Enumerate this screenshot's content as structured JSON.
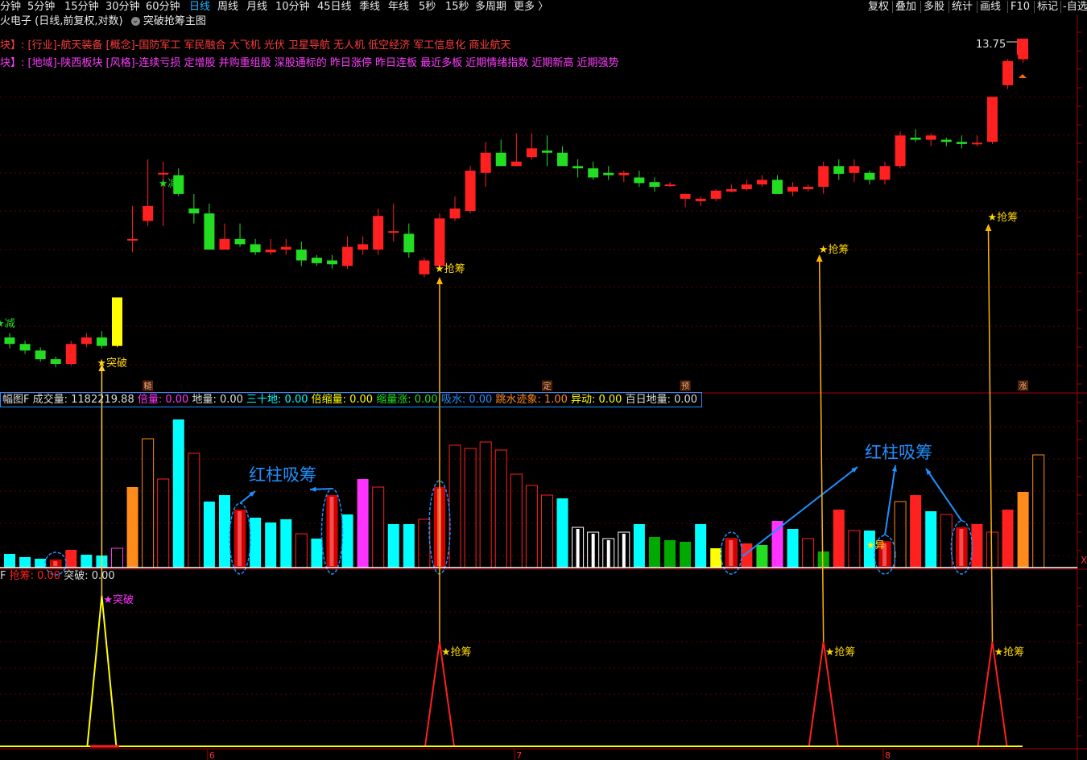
{
  "topbar": {
    "periods": [
      "分钟",
      "5分钟",
      "15分钟",
      "30分钟",
      "60分钟",
      "日线",
      "周线",
      "月线",
      "10分钟",
      "45日线",
      "季线",
      "年线",
      "5秒",
      "15秒",
      "多周期",
      "更多 〉"
    ],
    "active_period": "日线",
    "right_buttons": [
      "复权",
      "叠加",
      "多股",
      "统计",
      "画线",
      "F10",
      "标记",
      "-自选"
    ]
  },
  "title": {
    "stock": "火电子 (日线,前复权,对数)",
    "formula": "突破抢筹主图"
  },
  "tags": {
    "line1_prefix": "块】:",
    "line1": "[行业]-航天装备 [概念]-国防军工 军民融合 大飞机 光伏 卫星导航 无人机 低空经济 军工信息化 商业航天",
    "line2_prefix": "块】:",
    "line2": "[地域]-陕西板块 [风格]-连续亏损 定增股 并购重组股 深股通标的 昨日涨停 昨日连板 最近多板 近期情绪指数 近期新高 近期强势"
  },
  "colors": {
    "up": "#ff2020",
    "down": "#22dd22",
    "cyan": "#00ffff",
    "magenta": "#ff33ff",
    "orange": "#ff8c1a",
    "yellow": "#ffff00",
    "darkgreen": "#00aa00",
    "annotation": "#1e90ff",
    "arrow": "#ffb400"
  },
  "price_panel": {
    "price_label": "13.75",
    "markers": [
      {
        "text": "★减",
        "candle": 0,
        "color": "#22dd22"
      },
      {
        "text": "★突破",
        "candle": 6,
        "color": "#ffd700"
      },
      {
        "text": "★减",
        "candle": 10,
        "color": "#22dd22"
      },
      {
        "text": "★抢筹",
        "candle": 28,
        "color": "#ffd700"
      },
      {
        "text": "★抢筹",
        "candle": 53,
        "color": "#ffd700"
      },
      {
        "text": "★抢筹",
        "candle": 64,
        "color": "#ffd700"
      }
    ],
    "badges": [
      {
        "text": "糙",
        "candle": 9
      },
      {
        "text": "定",
        "candle": 35
      },
      {
        "text": "预",
        "candle": 44
      },
      {
        "text": "涨",
        "candle": 66
      }
    ]
  },
  "volume_panel": {
    "header": [
      {
        "text": "幅图F ",
        "color": "#dddddd"
      },
      {
        "text": "成交量: 1182219.88 ",
        "color": "#dddddd"
      },
      {
        "text": "倍量: 0.00 ",
        "color": "#ff33ff"
      },
      {
        "text": "地量: 0.00 ",
        "color": "#dddddd"
      },
      {
        "text": "三十地: 0.00 ",
        "color": "#00ffff"
      },
      {
        "text": "倍缩量: 0.00 ",
        "color": "#ffff00"
      },
      {
        "text": "缩量涨: 0.00 ",
        "color": "#22dd22"
      },
      {
        "text": "吸水: 0.00 ",
        "color": "#1e90ff"
      },
      {
        "text": "跳水迹象: 1.00 ",
        "color": "#ff8c1a"
      },
      {
        "text": "异动: 0.00 ",
        "color": "#ffff00"
      },
      {
        "text": "百日地量: 0.00",
        "color": "#dddddd"
      }
    ],
    "annotation_text": "红柱吸筹",
    "yi_label": "★异"
  },
  "signal_panel": {
    "header": [
      {
        "text": "F ",
        "color": "#dddddd"
      },
      {
        "text": "抢筹: 0.00 ",
        "color": "#ff2020"
      },
      {
        "text": "突破: 0.00",
        "color": "#dddddd"
      }
    ],
    "labels": [
      {
        "text": "★突破",
        "candle": 6,
        "color": "#ff33ff"
      },
      {
        "text": "★抢筹",
        "candle": 28,
        "color": "#ffd700"
      },
      {
        "text": "★抢筹",
        "candle": 53,
        "color": "#ffd700"
      },
      {
        "text": "★抢筹",
        "candle": 64,
        "color": "#ffd700"
      }
    ]
  },
  "x_axis_labels": [
    {
      "text": "6",
      "candle": 13
    },
    {
      "text": "7",
      "candle": 33
    },
    {
      "text": "8",
      "candle": 57
    }
  ],
  "chart_data": {
    "type": "candlestick",
    "scale": "log",
    "ohlc": [
      [
        7.55,
        7.62,
        7.38,
        7.45
      ],
      [
        7.45,
        7.5,
        7.3,
        7.35
      ],
      [
        7.35,
        7.4,
        7.18,
        7.22
      ],
      [
        7.22,
        7.26,
        7.1,
        7.15
      ],
      [
        7.15,
        7.5,
        7.12,
        7.45
      ],
      [
        7.45,
        7.62,
        7.4,
        7.55
      ],
      [
        7.55,
        7.65,
        7.38,
        7.42
      ],
      [
        7.42,
        8.2,
        7.4,
        8.2
      ],
      [
        9.25,
        9.9,
        9.0,
        9.25
      ],
      [
        9.6,
        10.9,
        9.5,
        9.9
      ],
      [
        10.6,
        10.85,
        9.5,
        10.6
      ],
      [
        10.55,
        10.7,
        10.1,
        10.15
      ],
      [
        9.85,
        10.15,
        9.55,
        9.75
      ],
      [
        9.75,
        9.95,
        9.1,
        9.05
      ],
      [
        9.05,
        9.55,
        9.2,
        9.25
      ],
      [
        9.25,
        9.55,
        9.1,
        9.15
      ],
      [
        9.15,
        9.25,
        8.95,
        9.0
      ],
      [
        9.0,
        9.25,
        8.95,
        9.05
      ],
      [
        9.05,
        9.25,
        8.95,
        9.1
      ],
      [
        9.05,
        9.2,
        8.75,
        8.85
      ],
      [
        8.9,
        8.95,
        8.75,
        8.8
      ],
      [
        8.85,
        8.95,
        8.7,
        8.78
      ],
      [
        8.75,
        9.3,
        8.7,
        9.1
      ],
      [
        9.05,
        9.3,
        8.95,
        9.15
      ],
      [
        9.05,
        9.85,
        8.95,
        9.7
      ],
      [
        9.4,
        9.95,
        9.2,
        9.4
      ],
      [
        9.35,
        9.55,
        8.9,
        9.0
      ],
      [
        8.6,
        8.9,
        8.55,
        8.85
      ],
      [
        8.75,
        9.75,
        8.7,
        9.65
      ],
      [
        9.65,
        10.1,
        9.6,
        9.85
      ],
      [
        9.8,
        10.75,
        9.75,
        10.65
      ],
      [
        10.6,
        11.3,
        10.3,
        11.05
      ],
      [
        11.05,
        11.35,
        10.8,
        10.75
      ],
      [
        10.75,
        11.5,
        10.8,
        10.85
      ],
      [
        10.95,
        11.5,
        10.9,
        11.15
      ],
      [
        11.1,
        11.45,
        10.75,
        11.05
      ],
      [
        11.05,
        11.2,
        10.8,
        10.75
      ],
      [
        10.75,
        10.9,
        10.5,
        10.7
      ],
      [
        10.7,
        10.85,
        10.45,
        10.5
      ],
      [
        10.6,
        10.75,
        10.45,
        10.55
      ],
      [
        10.55,
        10.65,
        10.4,
        10.6
      ],
      [
        10.5,
        10.65,
        10.3,
        10.38
      ],
      [
        10.4,
        10.5,
        10.2,
        10.3
      ],
      [
        10.35,
        10.4,
        10.3,
        10.35
      ],
      [
        10.05,
        10.15,
        9.88,
        10.15
      ],
      [
        10.0,
        10.1,
        9.9,
        10.05
      ],
      [
        10.05,
        10.25,
        10.0,
        10.22
      ],
      [
        10.2,
        10.35,
        10.18,
        10.25
      ],
      [
        10.25,
        10.45,
        10.22,
        10.35
      ],
      [
        10.35,
        10.55,
        10.3,
        10.45
      ],
      [
        10.45,
        10.55,
        10.15,
        10.15
      ],
      [
        10.2,
        10.4,
        10.1,
        10.3
      ],
      [
        10.25,
        10.35,
        10.2,
        10.3
      ],
      [
        10.3,
        10.85,
        10.15,
        10.75
      ],
      [
        10.75,
        10.9,
        10.45,
        10.58
      ],
      [
        10.6,
        10.9,
        10.4,
        10.75
      ],
      [
        10.6,
        10.65,
        10.35,
        10.45
      ],
      [
        10.45,
        10.85,
        10.35,
        10.75
      ],
      [
        10.75,
        11.55,
        10.7,
        11.45
      ],
      [
        11.4,
        11.6,
        11.3,
        11.35
      ],
      [
        11.35,
        11.5,
        11.2,
        11.45
      ],
      [
        11.35,
        11.4,
        11.2,
        11.3
      ],
      [
        11.3,
        11.45,
        11.15,
        11.25
      ],
      [
        11.25,
        11.45,
        11.2,
        11.28
      ],
      [
        11.3,
        12.4,
        11.25,
        12.4
      ],
      [
        12.7,
        13.4,
        12.6,
        13.35
      ],
      [
        13.4,
        13.75,
        13.3,
        13.75
      ]
    ],
    "volume_bars": [
      {
        "v": 0.085,
        "c": "cyan"
      },
      {
        "v": 0.065,
        "c": "cyan"
      },
      {
        "v": 0.055,
        "c": "cyan"
      },
      {
        "v": 0.05,
        "c": "cyan"
      },
      {
        "v": 0.11,
        "c": "up_fill"
      },
      {
        "v": 0.08,
        "c": "cyan"
      },
      {
        "v": 0.075,
        "c": "cyan"
      },
      {
        "v": 0.12,
        "c": "magenta_hollow"
      },
      {
        "v": 0.5,
        "c": "orange"
      },
      {
        "v": 0.8,
        "c": "orange_hollow"
      },
      {
        "v": 0.55,
        "c": "up_hollow"
      },
      {
        "v": 0.92,
        "c": "cyan"
      },
      {
        "v": 0.71,
        "c": "up_hollow"
      },
      {
        "v": 0.41,
        "c": "cyan"
      },
      {
        "v": 0.45,
        "c": "cyan"
      },
      {
        "v": 0.36,
        "c": "up_fill"
      },
      {
        "v": 0.31,
        "c": "cyan"
      },
      {
        "v": 0.28,
        "c": "cyan"
      },
      {
        "v": 0.3,
        "c": "cyan"
      },
      {
        "v": 0.21,
        "c": "up_hollow"
      },
      {
        "v": 0.18,
        "c": "cyan"
      },
      {
        "v": 0.45,
        "c": "up_fill"
      },
      {
        "v": 0.33,
        "c": "cyan"
      },
      {
        "v": 0.55,
        "c": "magenta_fill"
      },
      {
        "v": 0.5,
        "c": "up_hollow"
      },
      {
        "v": 0.27,
        "c": "cyan"
      },
      {
        "v": 0.27,
        "c": "cyan"
      },
      {
        "v": 0.3,
        "c": "up_hollow"
      },
      {
        "v": 0.5,
        "c": "up_fill"
      },
      {
        "v": 0.76,
        "c": "up_hollow"
      },
      {
        "v": 0.74,
        "c": "up_hollow"
      },
      {
        "v": 0.78,
        "c": "up_hollow"
      },
      {
        "v": 0.73,
        "c": "up_hollow"
      },
      {
        "v": 0.58,
        "c": "up_hollow"
      },
      {
        "v": 0.51,
        "c": "up_hollow"
      },
      {
        "v": 0.45,
        "c": "up_hollow"
      },
      {
        "v": 0.43,
        "c": "cyan"
      },
      {
        "v": 0.25,
        "c": "white_hollow"
      },
      {
        "v": 0.22,
        "c": "white_hollow"
      },
      {
        "v": 0.18,
        "c": "white_hollow"
      },
      {
        "v": 0.22,
        "c": "white_hollow"
      },
      {
        "v": 0.27,
        "c": "cyan"
      },
      {
        "v": 0.19,
        "c": "darkgreen"
      },
      {
        "v": 0.17,
        "c": "darkgreen"
      },
      {
        "v": 0.16,
        "c": "darkgreen"
      },
      {
        "v": 0.27,
        "c": "cyan"
      },
      {
        "v": 0.12,
        "c": "yellow"
      },
      {
        "v": 0.18,
        "c": "up_hollow"
      },
      {
        "v": 0.15,
        "c": "up_fill"
      },
      {
        "v": 0.14,
        "c": "green_fill"
      },
      {
        "v": 0.29,
        "c": "magenta_fill"
      },
      {
        "v": 0.24,
        "c": "cyan"
      },
      {
        "v": 0.18,
        "c": "up_hollow"
      },
      {
        "v": 0.1,
        "c": "darkgreen"
      },
      {
        "v": 0.36,
        "c": "up_fill"
      },
      {
        "v": 0.23,
        "c": "up_hollow"
      },
      {
        "v": 0.23,
        "c": "cyan"
      },
      {
        "v": 0.16,
        "c": "up_hollow"
      },
      {
        "v": 0.41,
        "c": "orange_hollow"
      },
      {
        "v": 0.45,
        "c": "up_fill"
      },
      {
        "v": 0.35,
        "c": "cyan"
      },
      {
        "v": 0.33,
        "c": "up_hollow"
      },
      {
        "v": 0.25,
        "c": "cyan"
      },
      {
        "v": 0.27,
        "c": "up_fill"
      },
      {
        "v": 0.22,
        "c": "up_hollow"
      },
      {
        "v": 0.36,
        "c": "up_fill"
      },
      {
        "v": 0.47,
        "c": "orange"
      },
      {
        "v": 0.7,
        "c": "orange_hollow"
      }
    ],
    "signal_spikes": [
      {
        "candle": 6,
        "kind": "突破"
      },
      {
        "candle": 28,
        "kind": "抢筹"
      },
      {
        "candle": 53,
        "kind": "抢筹"
      },
      {
        "candle": 64,
        "kind": "抢筹"
      }
    ],
    "highlighted_volume_bars": [
      3,
      15,
      21,
      28,
      47,
      57,
      62
    ],
    "annotation_arrows": [
      {
        "from_bar": 15,
        "label": 1
      },
      {
        "from_bar": 21,
        "label": 1
      },
      {
        "from_bar": 47,
        "label": 2
      },
      {
        "from_bar": 57,
        "label": 2
      },
      {
        "from_bar": 62,
        "label": 2
      }
    ]
  }
}
